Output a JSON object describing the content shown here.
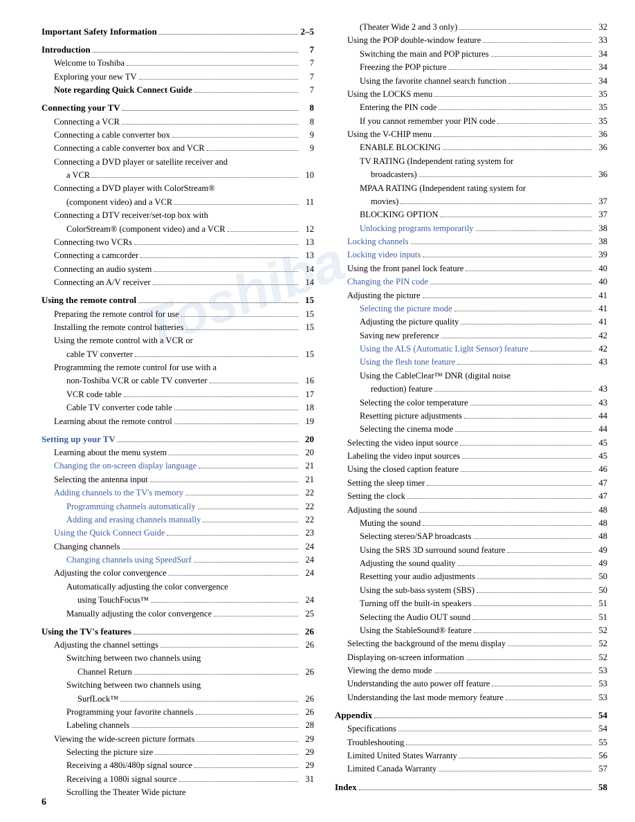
{
  "page_number": "6",
  "left_column": [
    {
      "level": "section",
      "label": "Important Safety Information ",
      "dots": true,
      "page": "2–5"
    },
    {
      "level": "section",
      "label": "Introduction",
      "dots": true,
      "page": "7"
    },
    {
      "level": "sub",
      "label": "Welcome to Toshiba ",
      "dots": true,
      "page": "7"
    },
    {
      "level": "sub",
      "label": "Exploring your new TV ",
      "dots": true,
      "page": "7"
    },
    {
      "level": "sub",
      "label": "Note regarding Quick Connect Guide ",
      "dots": true,
      "page": "7",
      "bold": true
    },
    {
      "level": "section",
      "label": "Connecting your TV ",
      "dots": true,
      "page": "8"
    },
    {
      "level": "sub",
      "label": "Connecting a VCR ",
      "dots": true,
      "page": "8"
    },
    {
      "level": "sub",
      "label": "Connecting a cable converter box ",
      "dots": true,
      "page": "9"
    },
    {
      "level": "sub",
      "label": "Connecting a cable converter box and VCR ",
      "dots": true,
      "page": "9"
    },
    {
      "level": "sub",
      "label": "Connecting a DVD player or satellite receiver and",
      "dots": false,
      "page": ""
    },
    {
      "level": "subsub",
      "label": "a VCR ",
      "dots": true,
      "page": "10"
    },
    {
      "level": "sub",
      "label": "Connecting a DVD player with ColorStream®",
      "dots": false,
      "page": ""
    },
    {
      "level": "subsub",
      "label": "(component video) and a VCR ",
      "dots": true,
      "page": "11"
    },
    {
      "level": "sub",
      "label": "Connecting a DTV receiver/set-top box with",
      "dots": false,
      "page": ""
    },
    {
      "level": "subsub",
      "label": "ColorStream® (component video) and a VCR ",
      "dots": true,
      "page": "12"
    },
    {
      "level": "sub",
      "label": "Connecting two VCRs ",
      "dots": true,
      "page": "13"
    },
    {
      "level": "sub",
      "label": "Connecting a camcorder ",
      "dots": true,
      "page": "13"
    },
    {
      "level": "sub",
      "label": "Connecting an audio system ",
      "dots": true,
      "page": "14"
    },
    {
      "level": "sub",
      "label": "Connecting an A/V receiver ",
      "dots": true,
      "page": "14"
    },
    {
      "level": "section",
      "label": "Using the remote control ",
      "dots": true,
      "page": "15"
    },
    {
      "level": "sub",
      "label": "Preparing the remote control for use ",
      "dots": true,
      "page": "15"
    },
    {
      "level": "sub",
      "label": "Installing the remote control batteries ",
      "dots": true,
      "page": "15"
    },
    {
      "level": "sub",
      "label": "Using the remote control with a VCR or",
      "dots": false,
      "page": ""
    },
    {
      "level": "subsub",
      "label": "cable TV converter ",
      "dots": true,
      "page": "15"
    },
    {
      "level": "sub",
      "label": "Programming the remote control for use with a",
      "dots": false,
      "page": ""
    },
    {
      "level": "subsub",
      "label": "non-Toshiba VCR or cable TV converter ",
      "dots": true,
      "page": "16"
    },
    {
      "level": "subsub",
      "label": "VCR code table ",
      "dots": true,
      "page": "17"
    },
    {
      "level": "subsub",
      "label": "Cable TV converter code table ",
      "dots": true,
      "page": "18"
    },
    {
      "level": "sub",
      "label": "Learning about the remote control ",
      "dots": true,
      "page": "19"
    },
    {
      "level": "section",
      "label": "Setting up your TV ",
      "dots": true,
      "page": "20"
    },
    {
      "level": "sub",
      "label": "Learning about the menu system ",
      "dots": true,
      "page": "20"
    },
    {
      "level": "sub",
      "label": "Changing the on-screen display language ",
      "dots": true,
      "page": "21"
    },
    {
      "level": "sub",
      "label": "Selecting the antenna input ",
      "dots": true,
      "page": "21"
    },
    {
      "level": "sub",
      "label": "Adding channels to the TV's memory ",
      "dots": true,
      "page": "22"
    },
    {
      "level": "subsub",
      "label": "Programming channels automatically ",
      "dots": true,
      "page": "22"
    },
    {
      "level": "subsub",
      "label": "Adding and erasing channels manually ",
      "dots": true,
      "page": "22"
    },
    {
      "level": "sub",
      "label": "Using the Quick Connect Guide ",
      "dots": true,
      "page": "23"
    },
    {
      "level": "sub",
      "label": "Changing channels ",
      "dots": true,
      "page": "24"
    },
    {
      "level": "subsub",
      "label": "Changing channels using SpeedSurf ",
      "dots": true,
      "page": "24"
    },
    {
      "level": "sub",
      "label": "Adjusting the color convergence ",
      "dots": true,
      "page": "24"
    },
    {
      "level": "subsub",
      "label": "Automatically adjusting the color convergence",
      "dots": false,
      "page": ""
    },
    {
      "level": "subsubsub",
      "label": "using TouchFocus™ ",
      "dots": true,
      "page": "24"
    },
    {
      "level": "subsub",
      "label": "Manually adjusting the color convergence ",
      "dots": true,
      "page": "25"
    },
    {
      "level": "section",
      "label": "Using the TV's features",
      "dots": true,
      "page": "26"
    },
    {
      "level": "sub",
      "label": "Adjusting the channel settings ",
      "dots": true,
      "page": "26"
    },
    {
      "level": "subsub",
      "label": "Switching between two channels using",
      "dots": false,
      "page": ""
    },
    {
      "level": "subsubsub",
      "label": "Channel Return ",
      "dots": true,
      "page": "26"
    },
    {
      "level": "subsub",
      "label": "Switching between two channels using",
      "dots": false,
      "page": ""
    },
    {
      "level": "subsubsub",
      "label": "SurfLock™ ",
      "dots": true,
      "page": "26"
    },
    {
      "level": "subsub",
      "label": "Programming your favorite channels ",
      "dots": true,
      "page": "26"
    },
    {
      "level": "subsub",
      "label": "Labeling channels ",
      "dots": true,
      "page": "28"
    },
    {
      "level": "sub",
      "label": "Viewing the wide-screen picture formats ",
      "dots": true,
      "page": "29"
    },
    {
      "level": "subsub",
      "label": "Selecting the picture size ",
      "dots": true,
      "page": "29"
    },
    {
      "level": "subsub",
      "label": "Receiving a 480i/480p signal source ",
      "dots": true,
      "page": "29"
    },
    {
      "level": "subsub",
      "label": "Receiving a 1080i signal source ",
      "dots": true,
      "page": "31"
    },
    {
      "level": "subsub",
      "label": "Scrolling the Theater Wide picture",
      "dots": false,
      "page": ""
    }
  ],
  "right_column": [
    {
      "level": "subsub",
      "label": "(Theater Wide 2 and 3 only) ",
      "dots": true,
      "page": "32"
    },
    {
      "level": "sub",
      "label": "Using the POP double-window feature ",
      "dots": true,
      "page": "33"
    },
    {
      "level": "subsub",
      "label": "Switching the main and POP pictures ",
      "dots": true,
      "page": "34"
    },
    {
      "level": "subsub",
      "label": "Freezing the POP picture ",
      "dots": true,
      "page": "34"
    },
    {
      "level": "subsub",
      "label": "Using the favorite channel search function ",
      "dots": true,
      "page": "34"
    },
    {
      "level": "sub",
      "label": "Using the LOCKS menu ",
      "dots": true,
      "page": "35"
    },
    {
      "level": "subsub",
      "label": "Entering the PIN code ",
      "dots": true,
      "page": "35"
    },
    {
      "level": "subsub",
      "label": "If you cannot remember your PIN code ",
      "dots": true,
      "page": "35"
    },
    {
      "level": "sub",
      "label": "Using the V-CHIP menu ",
      "dots": true,
      "page": "36"
    },
    {
      "level": "subsub",
      "label": "ENABLE BLOCKING ",
      "dots": true,
      "page": "36"
    },
    {
      "level": "subsub",
      "label": "TV RATING (Independent rating system for",
      "dots": false,
      "page": ""
    },
    {
      "level": "subsubsub",
      "label": "broadcasters) ",
      "dots": true,
      "page": "36"
    },
    {
      "level": "subsub",
      "label": "MPAA RATING (Independent rating system for",
      "dots": false,
      "page": ""
    },
    {
      "level": "subsubsub",
      "label": "movies) ",
      "dots": true,
      "page": "37"
    },
    {
      "level": "subsub",
      "label": "BLOCKING OPTION ",
      "dots": true,
      "page": "37"
    },
    {
      "level": "subsub",
      "label": "Unlocking programs temporarily ",
      "dots": true,
      "page": "38"
    },
    {
      "level": "sub",
      "label": "Locking channels ",
      "dots": true,
      "page": "38"
    },
    {
      "level": "sub",
      "label": "Locking video inputs ",
      "dots": true,
      "page": "39"
    },
    {
      "level": "sub",
      "label": "Using the front panel lock feature ",
      "dots": true,
      "page": "40"
    },
    {
      "level": "sub",
      "label": "Changing the PIN code ",
      "dots": true,
      "page": "40"
    },
    {
      "level": "sub",
      "label": "Adjusting the picture ",
      "dots": true,
      "page": "41"
    },
    {
      "level": "subsub",
      "label": "Selecting the picture mode ",
      "dots": true,
      "page": "41"
    },
    {
      "level": "subsub",
      "label": "Adjusting the picture quality ",
      "dots": true,
      "page": "41"
    },
    {
      "level": "subsub",
      "label": "Saving new preference ",
      "dots": true,
      "page": "42"
    },
    {
      "level": "subsub",
      "label": "Using the ALS (Automatic Light Sensor) feature ",
      "dots": true,
      "page": "42"
    },
    {
      "level": "subsub",
      "label": "Using the flesh tone feature ",
      "dots": true,
      "page": "43"
    },
    {
      "level": "subsub",
      "label": "Using the CableClear™ DNR (digital noise",
      "dots": false,
      "page": ""
    },
    {
      "level": "subsubsub",
      "label": "reduction) feature ",
      "dots": true,
      "page": "43"
    },
    {
      "level": "subsub",
      "label": "Selecting the color temperature ",
      "dots": true,
      "page": "43"
    },
    {
      "level": "subsub",
      "label": "Resetting picture adjustments ",
      "dots": true,
      "page": "44"
    },
    {
      "level": "subsub",
      "label": "Selecting the cinema mode ",
      "dots": true,
      "page": "44"
    },
    {
      "level": "sub",
      "label": "Selecting the video input source ",
      "dots": true,
      "page": "45"
    },
    {
      "level": "sub",
      "label": "Labeling the video input sources ",
      "dots": true,
      "page": "45"
    },
    {
      "level": "sub",
      "label": "Using the closed caption feature ",
      "dots": true,
      "page": "46"
    },
    {
      "level": "sub",
      "label": "Setting the sleep timer ",
      "dots": true,
      "page": "47"
    },
    {
      "level": "sub",
      "label": "Setting the clock ",
      "dots": true,
      "page": "47"
    },
    {
      "level": "sub",
      "label": "Adjusting the sound ",
      "dots": true,
      "page": "48"
    },
    {
      "level": "subsub",
      "label": "Muting the sound ",
      "dots": true,
      "page": "48"
    },
    {
      "level": "subsub",
      "label": "Selecting stereo/SAP broadcasts ",
      "dots": true,
      "page": "48"
    },
    {
      "level": "subsub",
      "label": "Using the SRS 3D surround sound feature ",
      "dots": true,
      "page": "49"
    },
    {
      "level": "subsub",
      "label": "Adjusting the sound quality ",
      "dots": true,
      "page": "49"
    },
    {
      "level": "subsub",
      "label": "Resetting your audio adjustments ",
      "dots": true,
      "page": "50"
    },
    {
      "level": "subsub",
      "label": "Using the sub-bass system (SBS) ",
      "dots": true,
      "page": "50"
    },
    {
      "level": "subsub",
      "label": "Turning off the built-in speakers ",
      "dots": true,
      "page": "51"
    },
    {
      "level": "subsub",
      "label": "Selecting the Audio OUT sound ",
      "dots": true,
      "page": "51"
    },
    {
      "level": "subsub",
      "label": "Using the StableSound® feature ",
      "dots": true,
      "page": "52"
    },
    {
      "level": "sub",
      "label": "Selecting the background of the menu display ",
      "dots": true,
      "page": "52"
    },
    {
      "level": "sub",
      "label": "Displaying on-screen information ",
      "dots": true,
      "page": "52"
    },
    {
      "level": "sub",
      "label": "Viewing the demo mode ",
      "dots": true,
      "page": "53"
    },
    {
      "level": "sub",
      "label": "Understanding the auto power off feature ",
      "dots": true,
      "page": "53"
    },
    {
      "level": "sub",
      "label": "Understanding the last mode memory feature ",
      "dots": true,
      "page": "53"
    },
    {
      "level": "section",
      "label": "Appendix",
      "dots": true,
      "page": "54"
    },
    {
      "level": "sub",
      "label": "Specifications ",
      "dots": true,
      "page": "54"
    },
    {
      "level": "sub",
      "label": "Troubleshooting ",
      "dots": true,
      "page": "55"
    },
    {
      "level": "sub",
      "label": "Limited United States Warranty ",
      "dots": true,
      "page": "56"
    },
    {
      "level": "sub",
      "label": "Limited Canada Warranty ",
      "dots": true,
      "page": "57"
    },
    {
      "level": "section",
      "label": "Index",
      "dots": true,
      "page": "58"
    }
  ]
}
